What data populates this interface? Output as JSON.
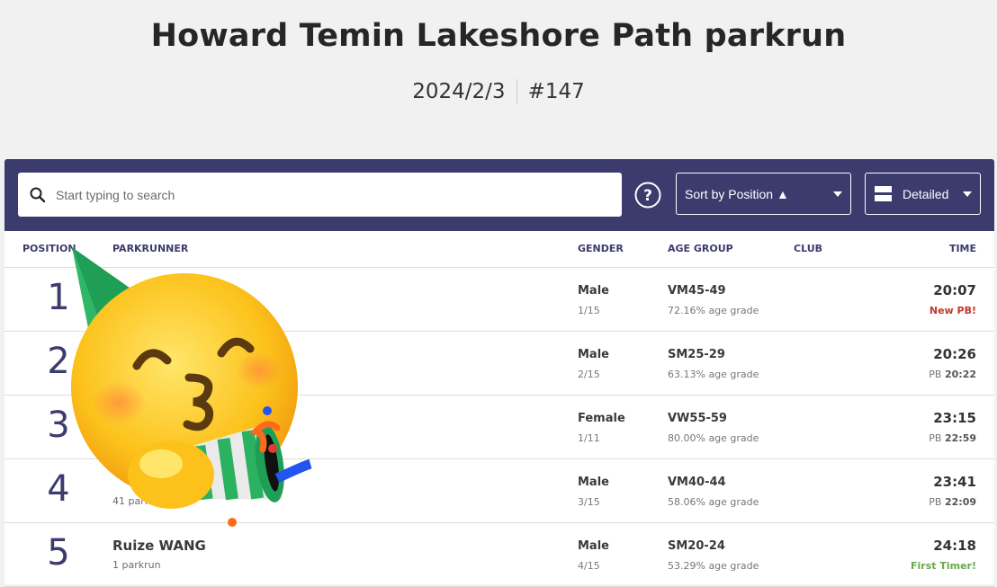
{
  "event": {
    "title": "Howard Temin Lakeshore Path parkrun",
    "date": "2024/2/3",
    "number": "#147"
  },
  "toolbar": {
    "search_placeholder": "Start typing to search",
    "sort_label": "Sort by Position ▲",
    "view_label": "Detailed",
    "bg_color": "#3c3b6e"
  },
  "columns": {
    "position": "POSITION",
    "parkrunner": "PARKRUNNER",
    "gender": "GENDER",
    "age_group": "AGE GROUP",
    "club": "CLUB",
    "time": "TIME"
  },
  "rows": [
    {
      "position": "1",
      "name": "",
      "runs": "",
      "gender": "Male",
      "gender_pos": "1/15",
      "age_group": "VM45-49",
      "age_grade": "72.16% age grade",
      "time": "20:07",
      "note": "New PB!",
      "note_type": "newpb",
      "pb_prefix": "",
      "pb_time": ""
    },
    {
      "position": "2",
      "name": "",
      "runs": "",
      "gender": "Male",
      "gender_pos": "2/15",
      "age_group": "SM25-29",
      "age_grade": "63.13% age grade",
      "time": "20:26",
      "note": "",
      "note_type": "pb",
      "pb_prefix": "PB",
      "pb_time": "20:22"
    },
    {
      "position": "3",
      "name": "",
      "runs": "",
      "gender": "Female",
      "gender_pos": "1/11",
      "age_group": "VW55-59",
      "age_grade": "80.00% age grade",
      "time": "23:15",
      "note": "",
      "note_type": "pb",
      "pb_prefix": "PB",
      "pb_time": "22:59"
    },
    {
      "position": "4",
      "name": "",
      "runs": "41 parkru",
      "gender": "Male",
      "gender_pos": "3/15",
      "age_group": "VM40-44",
      "age_grade": "58.06% age grade",
      "time": "23:41",
      "note": "",
      "note_type": "pb",
      "pb_prefix": "PB",
      "pb_time": "22:09"
    },
    {
      "position": "5",
      "name": "Ruize WANG",
      "runs": "1 parkrun",
      "gender": "Male",
      "gender_pos": "4/15",
      "age_group": "SM20-24",
      "age_grade": "53.29% age grade",
      "time": "24:18",
      "note": "First Timer!",
      "note_type": "first",
      "pb_prefix": "",
      "pb_time": ""
    }
  ],
  "colors": {
    "new_pb": "#c0392b",
    "first_timer": "#6aa84f",
    "position_number": "#3c3b6e"
  }
}
